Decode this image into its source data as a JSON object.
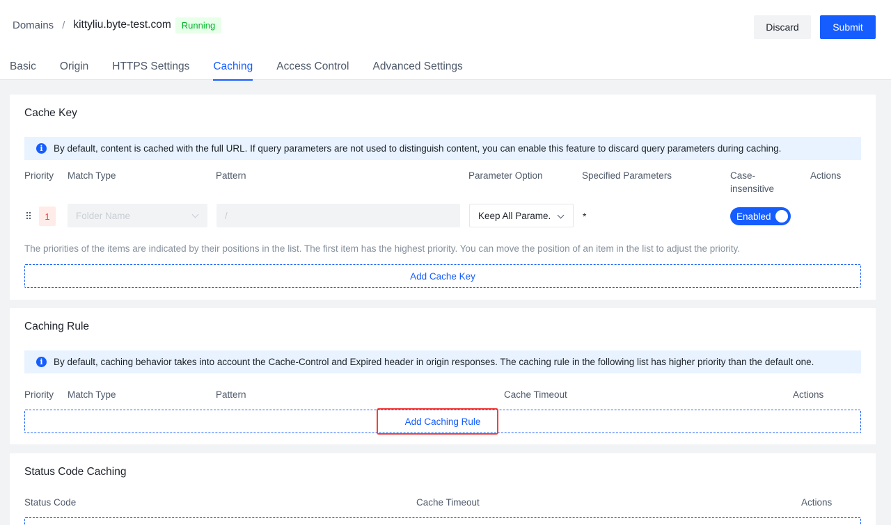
{
  "breadcrumb": {
    "root": "Domains",
    "separator": "/",
    "current": "kittyliu.byte-test.com",
    "status": "Running"
  },
  "actions": {
    "discard": "Discard",
    "submit": "Submit"
  },
  "tabs": [
    {
      "label": "Basic",
      "active": false
    },
    {
      "label": "Origin",
      "active": false
    },
    {
      "label": "HTTPS Settings",
      "active": false
    },
    {
      "label": "Caching",
      "active": true
    },
    {
      "label": "Access Control",
      "active": false
    },
    {
      "label": "Advanced Settings",
      "active": false
    }
  ],
  "cache_key": {
    "title": "Cache Key",
    "info": "By default, content is cached with the full URL. If query parameters are not used to distinguish content, you can enable this feature to discard query parameters during caching.",
    "columns": {
      "priority": "Priority",
      "match_type": "Match Type",
      "pattern": "Pattern",
      "parameter_option": "Parameter Option",
      "specified_parameters": "Specified Parameters",
      "case_insensitive_1": "Case-",
      "case_insensitive_2": "insensitive",
      "actions": "Actions"
    },
    "row": {
      "priority": "1",
      "match_type_placeholder": "Folder Name",
      "pattern_placeholder": "/",
      "parameter_option": "Keep All Parame.",
      "specified_parameters": "*",
      "case_insensitive": "Enabled"
    },
    "hint": "The priorities of the items are indicated by their positions in the list. The first item has the highest priority. You can move the position of an item in the list to adjust the priority.",
    "add_button": "Add Cache Key"
  },
  "caching_rule": {
    "title": "Caching Rule",
    "info": "By default, caching behavior takes into account the Cache-Control and Expired header in origin responses. The caching rule in the following list has higher priority than the default one.",
    "columns": {
      "priority": "Priority",
      "match_type": "Match Type",
      "pattern": "Pattern",
      "cache_timeout": "Cache Timeout",
      "actions": "Actions"
    },
    "add_button": "Add Caching Rule"
  },
  "status_code_caching": {
    "title": "Status Code Caching",
    "columns": {
      "status_code": "Status Code",
      "cache_timeout": "Cache Timeout",
      "actions": "Actions"
    }
  },
  "colors": {
    "primary": "#165dff",
    "success": "#00b42a",
    "danger": "#f53f3f",
    "highlight": "#f53f3f"
  }
}
